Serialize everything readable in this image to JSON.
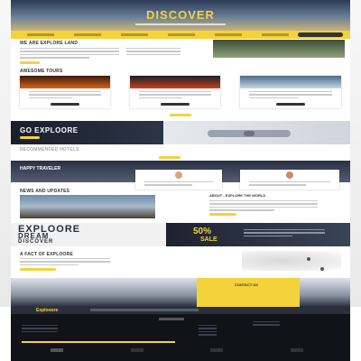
{
  "hero": {
    "title": "DISCOVER"
  },
  "nav_items": [
    "",
    "",
    "",
    "",
    "",
    ""
  ],
  "section_about": {
    "heading": "WE ARE EXPLORE LAND"
  },
  "section_tours": {
    "heading": "AWESOME TOURS",
    "cards": [
      {
        "button": ""
      },
      {
        "button": ""
      },
      {
        "button": ""
      }
    ],
    "more_button": ""
  },
  "section_explore": {
    "heading": "GO EXPLOORE"
  },
  "section_hotels": {
    "heading": "RECOMMENDED HOTELS",
    "button": ""
  },
  "section_travelers": {
    "heading": "HAPPY TRAVELER"
  },
  "section_news": {
    "heading": "NEWS AND UPDATES",
    "article_title": "ABOUT - EXPLORE THE WORLD",
    "read_more": ""
  },
  "promo": {
    "line1": "EXPLOORE",
    "line2": "DREAM",
    "line3": "DISCOVER",
    "sale_value": "50%",
    "sale_label": "SALE"
  },
  "section_fact": {
    "heading": "A FACT OF EXPLOORE"
  },
  "contact": {
    "heading": "CONTACT US"
  },
  "footer": {
    "newsletter_brand": "Explooore",
    "bottom_buttons": [
      "",
      "",
      "",
      ""
    ]
  },
  "colors": {
    "accent": "#f4d23c",
    "dark": "#1d2230"
  }
}
